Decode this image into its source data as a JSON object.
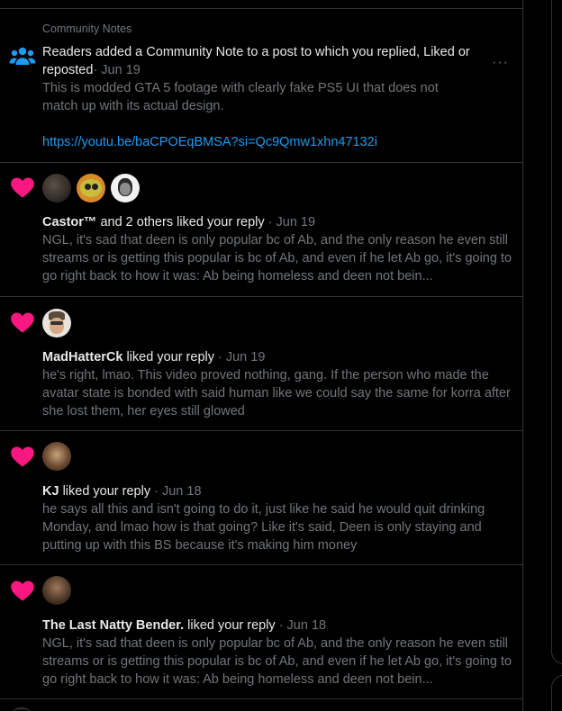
{
  "colors": {
    "background": "#000000",
    "heart": "#f91880",
    "link": "#1d9bf0",
    "people_icon": "#1d9bf0",
    "muted": "#71767b",
    "divider": "#2f3336"
  },
  "community_note": {
    "header": "Community Notes",
    "title": "Readers added a Community Note to a post to which you replied, Liked or reposted",
    "date": "· Jun 19",
    "body": "This is modded GTA 5 footage with clearly fake PS5 UI that does not match up with its actual design.",
    "link": "https://youtu.be/baCPOEqBMSA?si=Qc9Qmw1xhn47132i",
    "more": "···",
    "icon": "people-icon"
  },
  "notifications": [
    {
      "icon": "heart-icon",
      "user": "Castor™",
      "action": " and 2 others liked your reply",
      "date": " · Jun 19",
      "text": "NGL, it's sad that deen is only popular bc of Ab, and the only reason he even still streams or is getting this popular is bc of Ab, and even if he let Ab go, it's going to go right back to how it was: Ab being homeless and deen not bein..."
    },
    {
      "icon": "heart-icon",
      "user": "MadHatterCk",
      "action": " liked your reply",
      "date": " · Jun 19",
      "text": "he's right, lmao. This video proved nothing, gang. If the person who made the avatar state is bonded with said human like we could say the same for korra after she lost them, her eyes still glowed"
    },
    {
      "icon": "heart-icon",
      "user": "KJ",
      "action": " liked your reply",
      "date": " · Jun 18",
      "text": "he says all this and isn't going to do it, just like he said he would quit drinking Monday, and lmao how is that going? Like it's said, Deen is only staying and putting up with this BS because it's making him money"
    },
    {
      "icon": "heart-icon",
      "user": "The Last Natty Bender.",
      "action": " liked your reply",
      "date": " · Jun 18",
      "text": "NGL, it's sad that deen is only popular bc of Ab, and the only reason he even still streams or is getting this popular is bc of Ab, and even if he let Ab go, it's going to go right back to how it was: Ab being homeless and deen not bein..."
    }
  ]
}
